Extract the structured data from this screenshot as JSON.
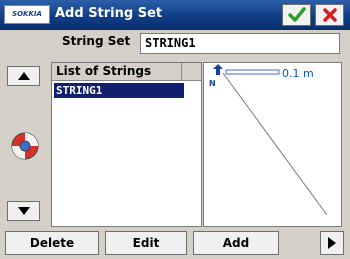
{
  "window": {
    "logo_text": "SOKKIA",
    "title": "Add String Set"
  },
  "string_set": {
    "label": "String Set",
    "value": "STRING1"
  },
  "list": {
    "header": "List of Strings",
    "items": [
      "STRING1"
    ]
  },
  "preview": {
    "scale_label": "0.1 m",
    "north_label": "N"
  },
  "buttons": {
    "delete": "Delete",
    "edit": "Edit",
    "add": "Add"
  },
  "icons": {
    "ok": "checkmark-icon",
    "cancel": "close-icon",
    "up": "triangle-up-icon",
    "down": "triangle-down-icon",
    "help": "lifebuoy-icon",
    "next": "triangle-right-icon"
  },
  "colors": {
    "title_bar": "#0f3d86",
    "selection": "#11206e",
    "ok_green": "#2aa02a",
    "cancel_red": "#d22020",
    "scale_blue": "#0a55d6"
  }
}
